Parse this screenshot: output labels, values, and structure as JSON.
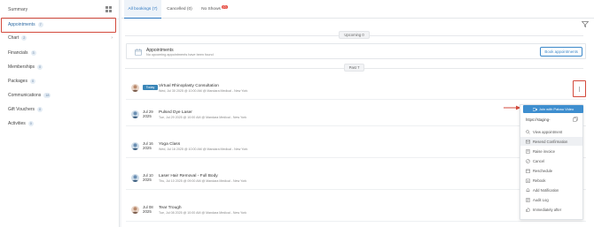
{
  "sidebar": {
    "summary_label": "Summary",
    "items": [
      {
        "label": "Appointments",
        "count": "7"
      },
      {
        "label": "Chart",
        "count": "2"
      },
      {
        "label": "Financials",
        "count": "3"
      },
      {
        "label": "Memberships",
        "count": "0"
      },
      {
        "label": "Packages",
        "count": "0"
      },
      {
        "label": "Communications",
        "count": "18"
      },
      {
        "label": "Gift Vouchers",
        "count": "0"
      },
      {
        "label": "Activities",
        "count": "0"
      }
    ]
  },
  "tabs": [
    {
      "label": "All bookings (7)"
    },
    {
      "label": "Cancelled (0)"
    },
    {
      "label": "No Shows",
      "badge": "(0)"
    }
  ],
  "sections": {
    "upcoming": "Upcoming 0",
    "past": "Past 7"
  },
  "upcoming_box": {
    "title": "Appointments",
    "subtitle": "No upcoming appointments have been found",
    "book_button": "Book appointments"
  },
  "bookings": [
    {
      "date_tag": "Today",
      "title": "Virtual Rhinoplasty Consultation",
      "details": "Wed, Jul 30 2025 @ 10:00 AM @ Mandara Medical - New York"
    },
    {
      "date_line1": "Jul 29",
      "date_line2": "2025",
      "title": "Pulsed Dye Laser",
      "details": "Tue, Jul 29 2025 @ 10:00 AM @ Mandara Medical - New York"
    },
    {
      "date_line1": "Jul 16",
      "date_line2": "2025",
      "title": "Yoga Class",
      "details": "Wed, Jul 16 2025 @ 10:00 AM @ Mandara Medical - New York"
    },
    {
      "date_line1": "Jul 10",
      "date_line2": "2025",
      "title": "Laser Hair Removal - Full Body",
      "details": "Thu, Jul 10 2025 @ 09:00 AM @ Mandara Medical - New York"
    },
    {
      "date_line1": "Jul 08",
      "date_line2": "2025",
      "title": "Tear Trough",
      "details": "Tue, Jul 08 2025 @ 10:00 AM @ Mandara Medical - New York"
    }
  ],
  "dropdown": {
    "join_button": "Join with Pabau Video",
    "link_text": "https://staging-",
    "items": [
      {
        "label": "View appointment",
        "icon": "search-icon"
      },
      {
        "label": "Resend Confirmation",
        "icon": "mail-icon"
      },
      {
        "label": "Raise invoice",
        "icon": "invoice-icon"
      },
      {
        "label": "Cancel",
        "icon": "cancel-icon"
      },
      {
        "label": "Reschedule",
        "icon": "calendar-icon"
      },
      {
        "label": "Rebook",
        "icon": "rebook-icon"
      },
      {
        "label": "Add Notification",
        "icon": "bell-icon"
      },
      {
        "label": "Audit Log",
        "icon": "log-icon"
      },
      {
        "label": "Immediately after",
        "icon": "thumb-icon"
      }
    ]
  },
  "colors": {
    "accent": "#3e8ecf",
    "highlight_frame": "#d34a3c",
    "badge_red": "#e5483d"
  }
}
